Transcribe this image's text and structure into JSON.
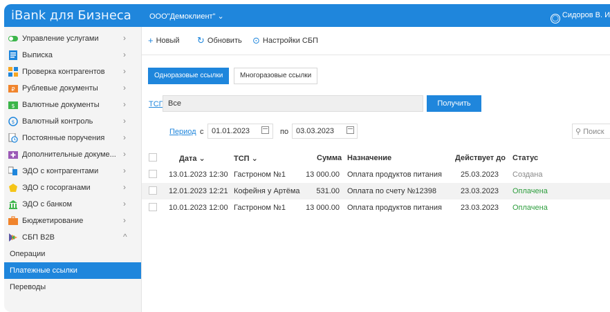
{
  "app": {
    "brand": "iBank для Бизнеса",
    "org": "ООО\"Демоклиент\" ⌄",
    "user": "Сидоров В. И"
  },
  "sidebar": {
    "items": [
      {
        "label": "Управление услугами",
        "icon": "toggle-icon",
        "chevron": "›"
      },
      {
        "label": "Выписка",
        "icon": "statement-icon",
        "chevron": "›"
      },
      {
        "label": "Проверка контрагентов",
        "icon": "grid-icon",
        "chevron": "›"
      },
      {
        "label": "Рублевые документы",
        "icon": "ruble-doc-icon",
        "chevron": "›"
      },
      {
        "label": "Валютные документы",
        "icon": "currency-doc-icon",
        "chevron": "›"
      },
      {
        "label": "Валютный контроль",
        "icon": "currency-control-icon",
        "chevron": "›"
      },
      {
        "label": "Постоянные поручения",
        "icon": "recurring-icon",
        "chevron": "›"
      },
      {
        "label": "Дополнительные докуме...",
        "icon": "extra-docs-icon",
        "chevron": "›"
      },
      {
        "label": "ЭДО с контрагентами",
        "icon": "edo-counterparty-icon",
        "chevron": "›"
      },
      {
        "label": "ЭДО с госорганами",
        "icon": "edo-gov-icon",
        "chevron": "›"
      },
      {
        "label": "ЭДО с банком",
        "icon": "bank-icon",
        "chevron": "›"
      },
      {
        "label": "Бюджетирование",
        "icon": "budget-icon",
        "chevron": "›"
      },
      {
        "label": "СБП B2B",
        "icon": "sbp-icon",
        "chevron": "^"
      }
    ],
    "subitems": [
      {
        "label": "Операции"
      },
      {
        "label": "Платежные ссылки"
      },
      {
        "label": "Переводы"
      }
    ]
  },
  "toolbar": {
    "new_label": "Новый",
    "refresh_label": "Обновить",
    "sbp_settings_label": "Настройки СБП"
  },
  "tabs": [
    {
      "label": "Одноразовые ссылки"
    },
    {
      "label": "Многоразовые ссылки"
    }
  ],
  "filter": {
    "tsp_label": "ТСП",
    "tsp_value": "Все",
    "get_button": "Получить",
    "period_label": "Период",
    "from_prefix": "с",
    "date_from": "01.01.2023",
    "to_prefix": "по",
    "date_to": "03.03.2023",
    "search_placeholder": "Поиск"
  },
  "table": {
    "columns": [
      "Дата ⌄",
      "ТСП ⌄",
      "Сумма",
      "Назначение",
      "Действует до",
      "Статус"
    ],
    "rows": [
      {
        "date": "13.01.2023 12:30",
        "tsp": "Гастроном №1",
        "amount": "13 000.00",
        "purpose": "Оплата продуктов питания",
        "valid_until": "25.03.2023",
        "status": "Создана"
      },
      {
        "date": "12.01.2023 12:21",
        "tsp": "Кофейня у Артёма",
        "amount": "531.00",
        "purpose": "Оплата по счету №12398",
        "valid_until": "23.03.2023",
        "status": "Оплачена"
      },
      {
        "date": "10.01.2023 12:00",
        "tsp": "Гастроном №1",
        "amount": "13 000.00",
        "purpose": "Оплата продуктов питания",
        "valid_until": "23.03.2023",
        "status": "Оплачена"
      }
    ]
  },
  "colors": {
    "accent": "#1f86dc",
    "paid": "#2e9e3e",
    "created": "#888888"
  }
}
